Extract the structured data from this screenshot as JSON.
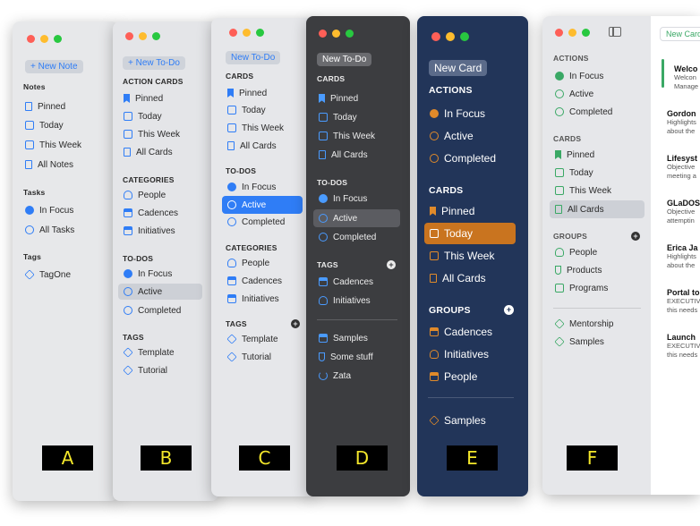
{
  "colors": {
    "blue_accent": "#2f7df6",
    "orange_accent": "#e08a2a",
    "green_accent": "#3aa865",
    "selected_blue": "#2f7df6",
    "selected_orange": "#c9741f",
    "label_bg": "#000000",
    "label_text": "#f3e62a"
  },
  "panelA": {
    "new_label": "+ New Note",
    "sections": [
      "Notes",
      "Tasks",
      "Tags"
    ],
    "notes": [
      "Pinned",
      "Today",
      "This Week",
      "All Notes"
    ],
    "tasks": [
      "In Focus",
      "All Tasks"
    ],
    "tags": [
      "TagOne"
    ],
    "badge": "A"
  },
  "panelB": {
    "new_label": "+ New To-Do",
    "sections": [
      "ACTION CARDS",
      "CATEGORIES",
      "TO-DOS",
      "TAGS"
    ],
    "cards": [
      "Pinned",
      "Today",
      "This Week",
      "All Cards"
    ],
    "categories": [
      "People",
      "Cadences",
      "Initiatives"
    ],
    "todos": [
      "In Focus",
      "Active",
      "Completed"
    ],
    "tags": [
      "Template",
      "Tutorial"
    ],
    "badge": "B"
  },
  "panelC": {
    "new_label": "New To-Do",
    "sections": [
      "CARDS",
      "TO-DOS",
      "CATEGORIES",
      "TAGS"
    ],
    "cards": [
      "Pinned",
      "Today",
      "This Week",
      "All Cards"
    ],
    "todos": [
      "In Focus",
      "Active",
      "Completed"
    ],
    "categories": [
      "People",
      "Cadences",
      "Initiatives"
    ],
    "tags": [
      "Template",
      "Tutorial"
    ],
    "badge": "C"
  },
  "panelD": {
    "new_label": "New To-Do",
    "sections": [
      "CARDS",
      "TO-DOS",
      "TAGS"
    ],
    "cards": [
      "Pinned",
      "Today",
      "This Week",
      "All Cards"
    ],
    "todos": [
      "In Focus",
      "Active",
      "Completed"
    ],
    "tags": [
      "Cadences",
      "Initiatives"
    ],
    "other": [
      "Samples",
      "Some stuff",
      "Zata"
    ],
    "badge": "D"
  },
  "panelE": {
    "new_label": "New Card",
    "sections": [
      "ACTIONS",
      "CARDS",
      "GROUPS"
    ],
    "actions": [
      "In Focus",
      "Active",
      "Completed"
    ],
    "cards": [
      "Pinned",
      "Today",
      "This Week",
      "All Cards"
    ],
    "groups": [
      "Cadences",
      "Initiatives",
      "People"
    ],
    "other": [
      "Samples"
    ],
    "badge": "E"
  },
  "panelF": {
    "new_label": "New Card",
    "sections": [
      "ACTIONS",
      "CARDS",
      "GROUPS"
    ],
    "actions": [
      "In Focus",
      "Active",
      "Completed"
    ],
    "cards": [
      "Pinned",
      "Today",
      "This Week",
      "All Cards"
    ],
    "groups": [
      "People",
      "Products",
      "Programs"
    ],
    "other": [
      "Mentorship",
      "Samples"
    ],
    "badge": "F",
    "list": [
      {
        "title": "Welco",
        "sub": [
          "Welcon",
          "Manage"
        ]
      },
      {
        "title": "Gordon",
        "sub": [
          "Highlights",
          "about the"
        ]
      },
      {
        "title": "Lifesyst",
        "sub": [
          "Objective",
          "meeting a"
        ]
      },
      {
        "title": "GLaDOS",
        "sub": [
          "Objective",
          "attemptin"
        ]
      },
      {
        "title": "Erica Ja",
        "sub": [
          "Highlights",
          "about the"
        ]
      },
      {
        "title": "Portal to",
        "sub": [
          "EXECUTIV",
          "this needs"
        ]
      },
      {
        "title": "Launch",
        "sub": [
          "EXECUTIV",
          "this needs"
        ]
      }
    ]
  }
}
